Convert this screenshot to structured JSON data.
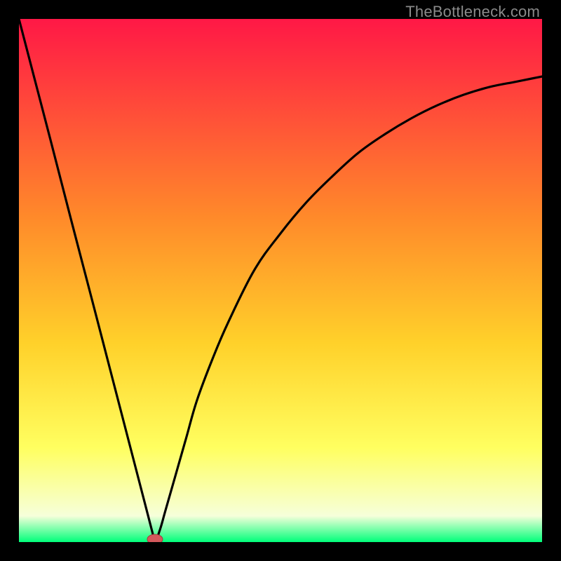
{
  "watermark": "TheBottleneck.com",
  "colors": {
    "top": "#ff1846",
    "mid_upper": "#ff8a2a",
    "mid": "#ffd12a",
    "mid_lower": "#ffff60",
    "near_bottom": "#f6ffda",
    "bottom": "#00ff7a",
    "curve": "#000000",
    "dot_fill": "#d3595c",
    "dot_stroke": "#a23c3e"
  },
  "chart_data": {
    "type": "line",
    "title": "",
    "xlabel": "",
    "ylabel": "",
    "xlim": [
      0,
      100
    ],
    "ylim": [
      0,
      100
    ],
    "x": [
      0,
      3,
      6,
      10,
      14,
      18,
      22,
      24,
      25.5,
      26,
      27,
      28,
      30,
      32,
      34,
      37,
      40,
      45,
      50,
      55,
      60,
      65,
      70,
      75,
      80,
      85,
      90,
      95,
      100
    ],
    "y": [
      100,
      88.5,
      77,
      61.5,
      46.2,
      30.8,
      15.4,
      7.7,
      1.9,
      0,
      2.5,
      6,
      13,
      20,
      27,
      35,
      42,
      52,
      59,
      65,
      70,
      74.5,
      78,
      81,
      83.5,
      85.5,
      87,
      88,
      89
    ],
    "marker": {
      "x": 26,
      "y": 0
    }
  }
}
